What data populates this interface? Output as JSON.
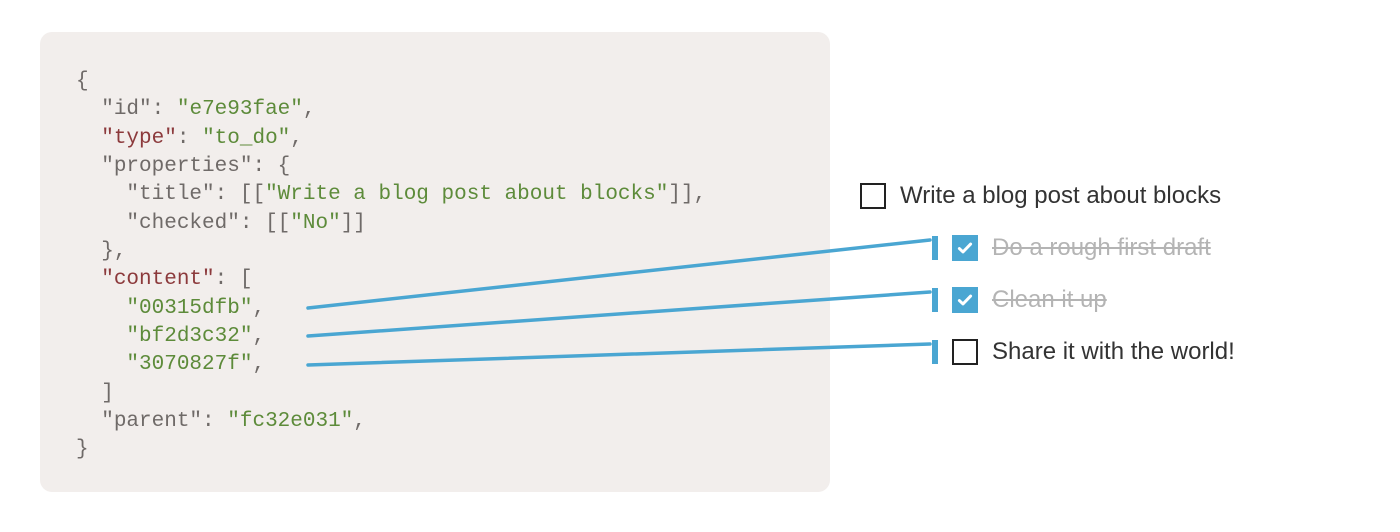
{
  "code": {
    "open_brace": "{",
    "id_key": "\"id\"",
    "id_value": "\"e7e93fae\"",
    "type_key": "\"type\"",
    "type_value": "\"to_do\"",
    "properties_key": "\"properties\"",
    "title_key": "\"title\"",
    "title_value": "\"Write a blog post about blocks\"",
    "checked_key": "\"checked\"",
    "checked_value": "\"No\"",
    "content_key": "\"content\"",
    "content_0": "\"00315dfb\"",
    "content_1": "\"bf2d3c32\"",
    "content_2": "\"3070827f\"",
    "parent_key": "\"parent\"",
    "parent_value": "\"fc32e031\"",
    "close_brace": "}",
    "colon": ":",
    "comma": ",",
    "open_curly": "{",
    "close_curly": "}",
    "open_sq": "[",
    "close_sq": "]",
    "dbl_open": "[[",
    "dbl_close": "]]"
  },
  "todos": {
    "items": [
      {
        "label": "Write a blog post about blocks",
        "checked": false,
        "sub": false
      },
      {
        "label": "Do a rough first draft",
        "checked": true,
        "sub": true
      },
      {
        "label": "Clean it up",
        "checked": true,
        "sub": true
      },
      {
        "label": "Share it with the world!",
        "checked": false,
        "sub": true
      }
    ]
  },
  "colors": {
    "accent": "#4aa6d2",
    "code_bg": "#f2eeec",
    "key": "#8c3a3c",
    "value": "#5d8b3a"
  }
}
